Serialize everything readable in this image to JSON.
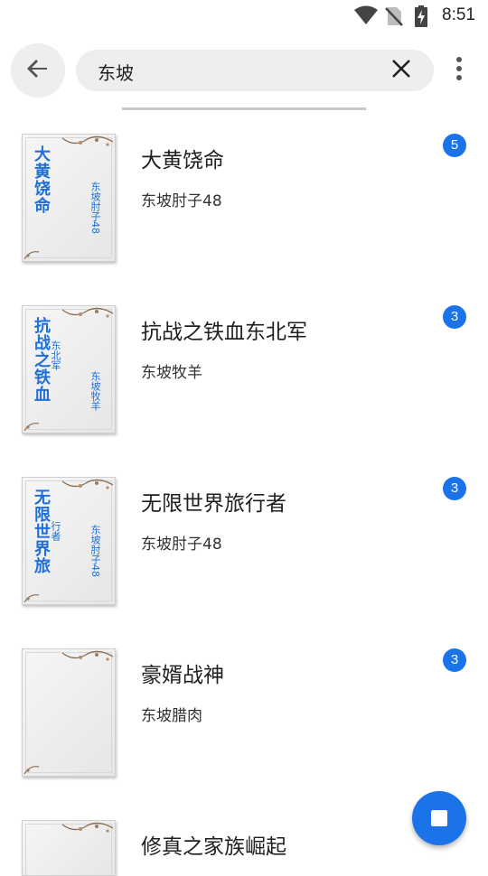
{
  "status_bar": {
    "time": "8:51",
    "icons": [
      "wifi-icon",
      "no-sim-icon",
      "battery-charging-icon"
    ]
  },
  "search": {
    "query": "东坡",
    "back_icon": "arrow-back-icon",
    "clear_icon": "close-icon",
    "menu_icon": "more-vert-icon"
  },
  "results": [
    {
      "title": "大黄饶命",
      "author": "东坡肘子48",
      "badge": "5",
      "cover_title": "大黄饶命",
      "cover_sub": "",
      "cover_author": "东坡肘子48"
    },
    {
      "title": "抗战之铁血东北军",
      "author": "东坡牧羊",
      "badge": "3",
      "cover_title": "抗战之铁血",
      "cover_sub": "东北军",
      "cover_author": "东坡牧羊"
    },
    {
      "title": "无限世界旅行者",
      "author": "东坡肘子48",
      "badge": "3",
      "cover_title": "无限世界旅",
      "cover_sub": "行者",
      "cover_author": "东坡肘子48"
    },
    {
      "title": "豪婿战神",
      "author": "东坡腊肉",
      "badge": "3",
      "cover_title": "",
      "cover_sub": "",
      "cover_author": ""
    },
    {
      "title": "修真之家族崛起",
      "author": "",
      "badge": "",
      "cover_title": "",
      "cover_sub": "",
      "cover_author": ""
    }
  ],
  "fab": {
    "icon": "stop-icon"
  },
  "colors": {
    "accent": "#1a73e8",
    "cover_text": "#1e6fd9",
    "search_bg": "#eeeeee"
  }
}
